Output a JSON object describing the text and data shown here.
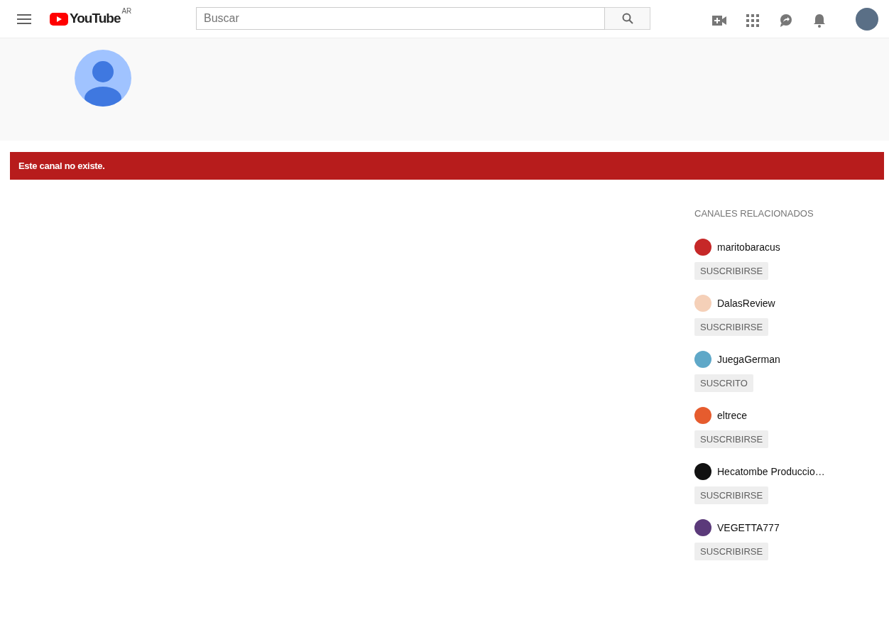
{
  "header": {
    "logo_text": "YouTube",
    "region": "AR",
    "search": {
      "placeholder": "Buscar"
    }
  },
  "error_banner": "Este canal no existe.",
  "related_channels": {
    "title": "CANALES RELACIONADOS",
    "items": [
      {
        "name": "maritobaracus",
        "button": "SUSCRIBIRSE",
        "color": "#c62828"
      },
      {
        "name": "DalasReview",
        "button": "SUSCRIBIRSE",
        "color": "#f5d0b8"
      },
      {
        "name": "JuegaGerman",
        "button": "SUSCRITO",
        "color": "#5fa8c8"
      },
      {
        "name": "eltrece",
        "button": "SUSCRIBIRSE",
        "color": "#e65c2e"
      },
      {
        "name": "Hecatombe Produccio…",
        "button": "SUSCRIBIRSE",
        "color": "#111111"
      },
      {
        "name": "VEGETTA777",
        "button": "SUSCRIBIRSE",
        "color": "#5b3a7a"
      }
    ]
  }
}
